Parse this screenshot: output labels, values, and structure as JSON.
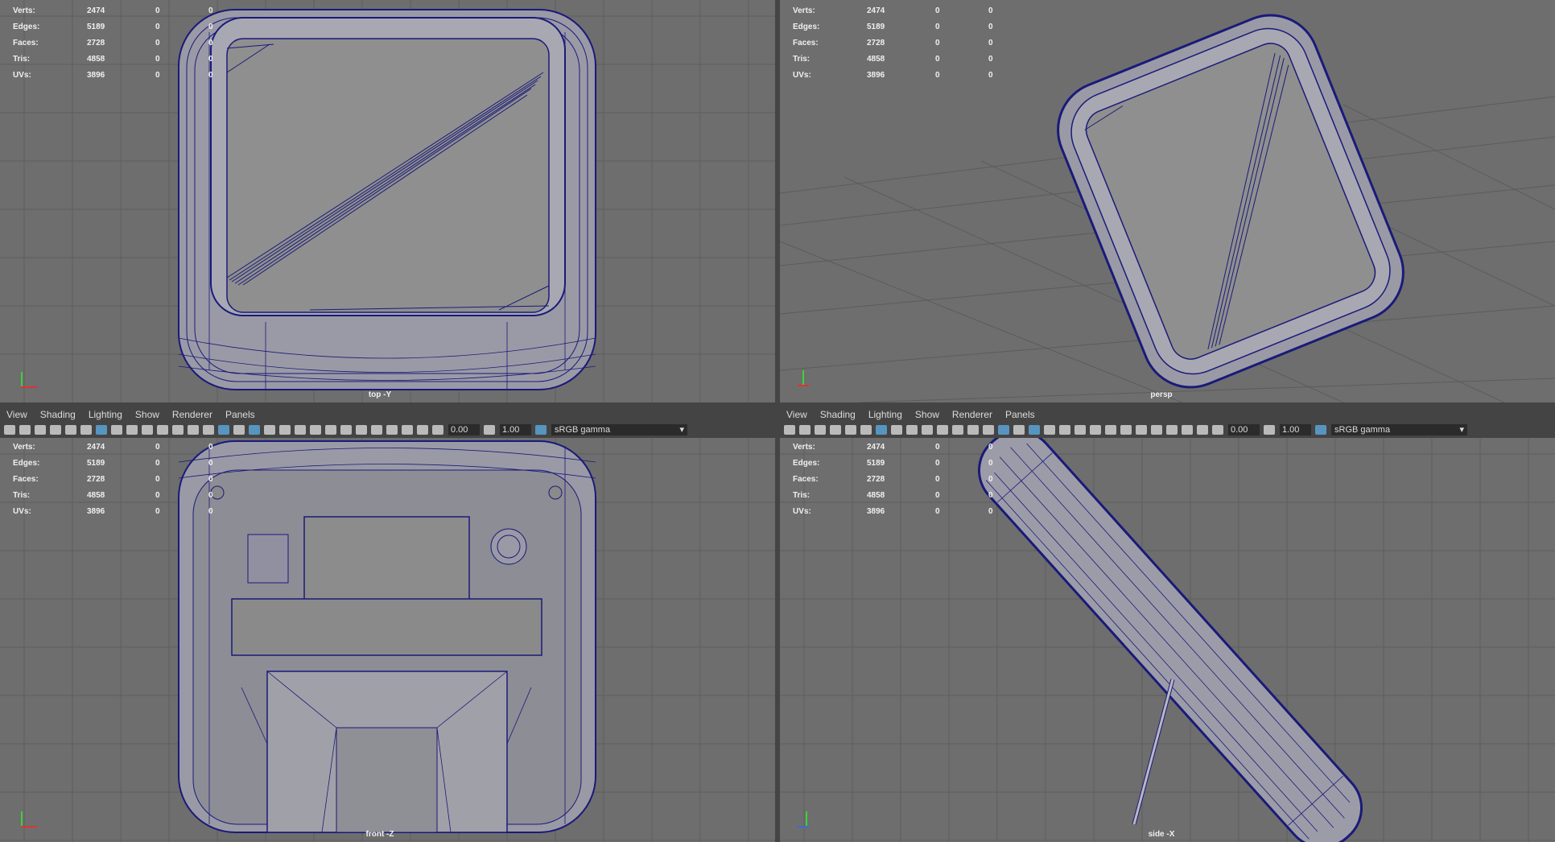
{
  "hud": {
    "rows": [
      {
        "label": "Verts:",
        "value": "2474",
        "a": "0",
        "b": "0"
      },
      {
        "label": "Edges:",
        "value": "5189",
        "a": "0",
        "b": "0"
      },
      {
        "label": "Faces:",
        "value": "2728",
        "a": "0",
        "b": "0"
      },
      {
        "label": "Tris:",
        "value": "4858",
        "a": "0",
        "b": "0"
      },
      {
        "label": "UVs:",
        "value": "3896",
        "a": "0",
        "b": "0"
      }
    ]
  },
  "menu": {
    "view": "View",
    "shading": "Shading",
    "lighting": "Lighting",
    "show": "Show",
    "renderer": "Renderer",
    "panels": "Panels"
  },
  "toolbar": {
    "exposure": "0.00",
    "gamma": "1.00",
    "color_space": "sRGB gamma"
  },
  "cameras": {
    "top": "top -Y",
    "persp": "persp",
    "front": "front -Z",
    "side": "side -X"
  },
  "colors": {
    "viewport_bg": "#6e6e6e",
    "wire": "#1a1a7a",
    "grid": "#5a5a5a",
    "ui_bg": "#444444"
  }
}
